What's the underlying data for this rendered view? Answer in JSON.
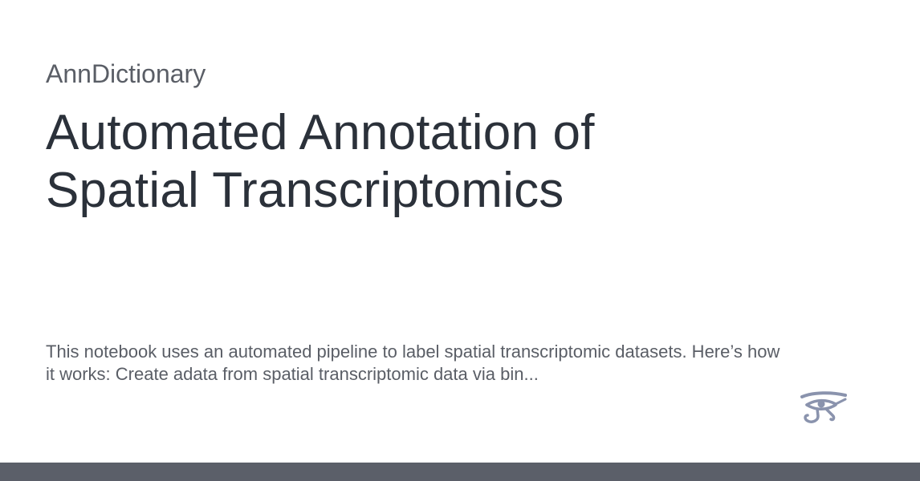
{
  "site": {
    "name": "AnnDictionary"
  },
  "page": {
    "title_line1": "Automated Annotation of",
    "title_line2": "Spatial Transcriptomics",
    "description_line1": "This notebook uses an automated pipeline to label spatial transcriptomic datasets. Here’s how",
    "description_line2": "it works: Create adata from spatial transcriptomic data via bin..."
  },
  "logo": {
    "icon": "eye-of-horus-icon",
    "color": "#8a93ad"
  },
  "colors": {
    "background": "#ffffff",
    "title": "#2b313a",
    "secondary_text": "#5a5e66",
    "footer_bar": "#5b5f69"
  }
}
